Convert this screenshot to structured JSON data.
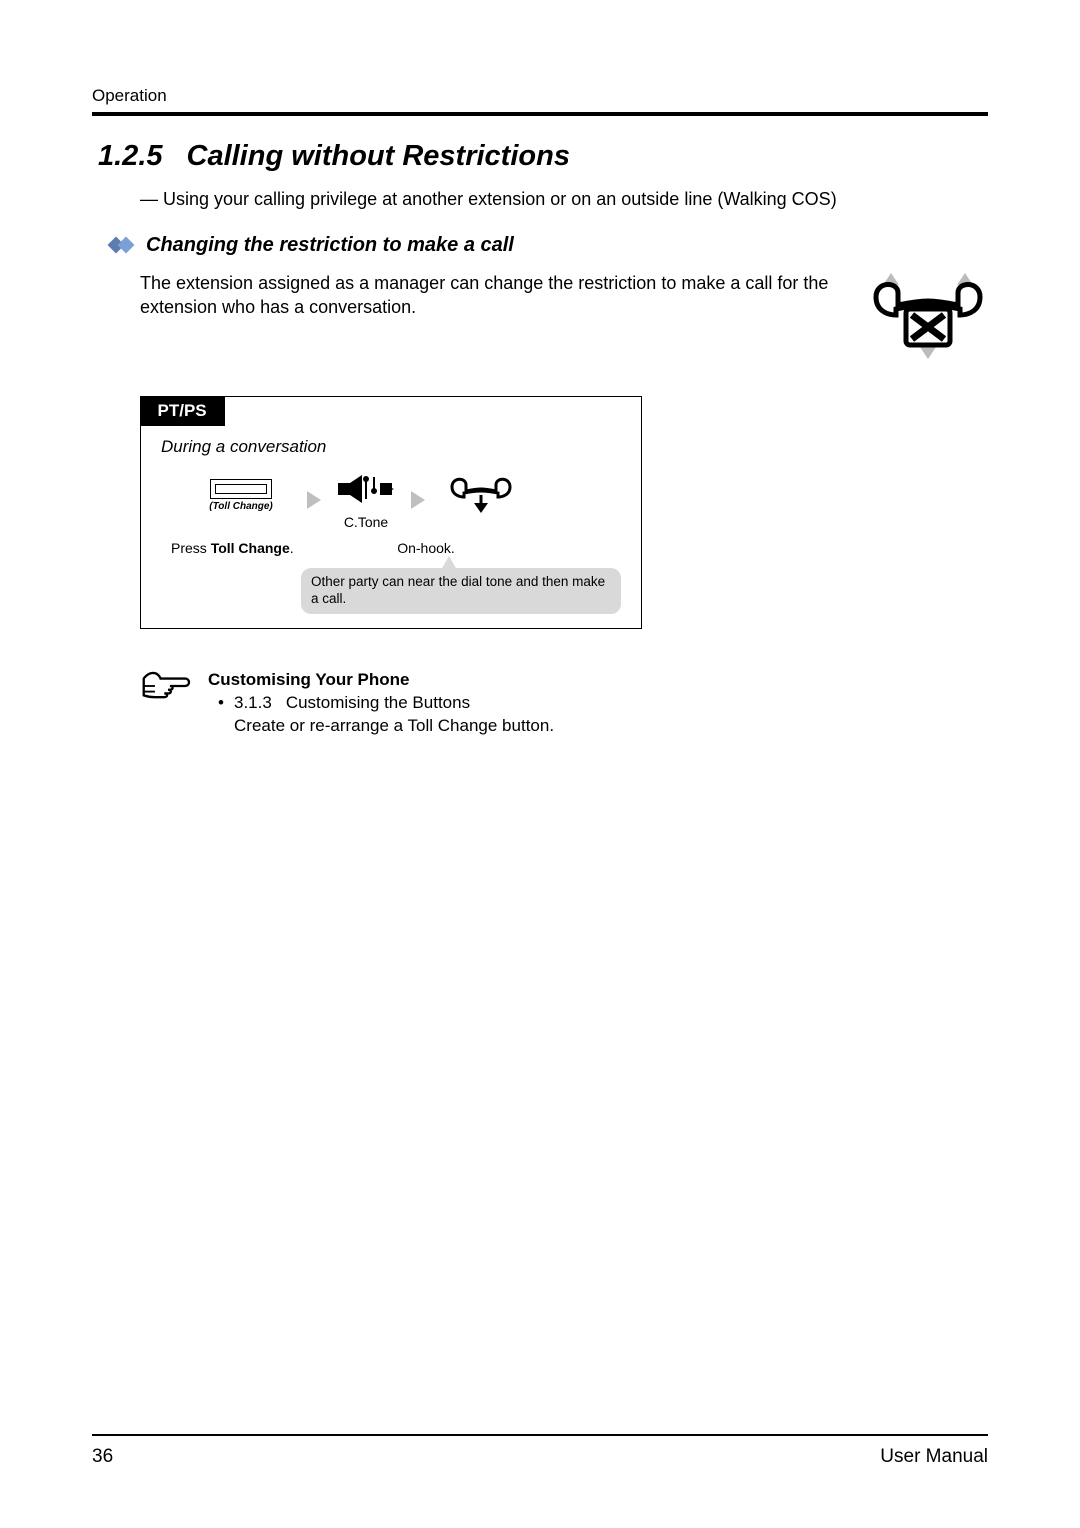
{
  "header": {
    "label": "Operation"
  },
  "section": {
    "number": "1.2.5",
    "title": "Calling without Restrictions",
    "dash_line": "— Using your calling privilege at another extension or on an outside line (Walking COS)"
  },
  "subsection": {
    "title": "Changing the restriction to make a call",
    "body": "The extension assigned as a manager can change the restriction to make a call for the extension who has a conversation."
  },
  "procedure": {
    "tab": "PT/PS",
    "context": "During a conversation",
    "button_label": "(Toll Change)",
    "ctone": "C.Tone",
    "caption1_pre": "Press ",
    "caption1_bold": "Toll Change",
    "caption1_post": ".",
    "caption3": "On-hook.",
    "note": "Other party can near the dial tone and then make a call."
  },
  "customising": {
    "heading": "Customising Your Phone",
    "ref_num": "3.1.3",
    "ref_title": "Customising the Buttons",
    "desc": "Create or re-arrange a Toll Change button."
  },
  "footer": {
    "page": "36",
    "doc": "User Manual"
  }
}
